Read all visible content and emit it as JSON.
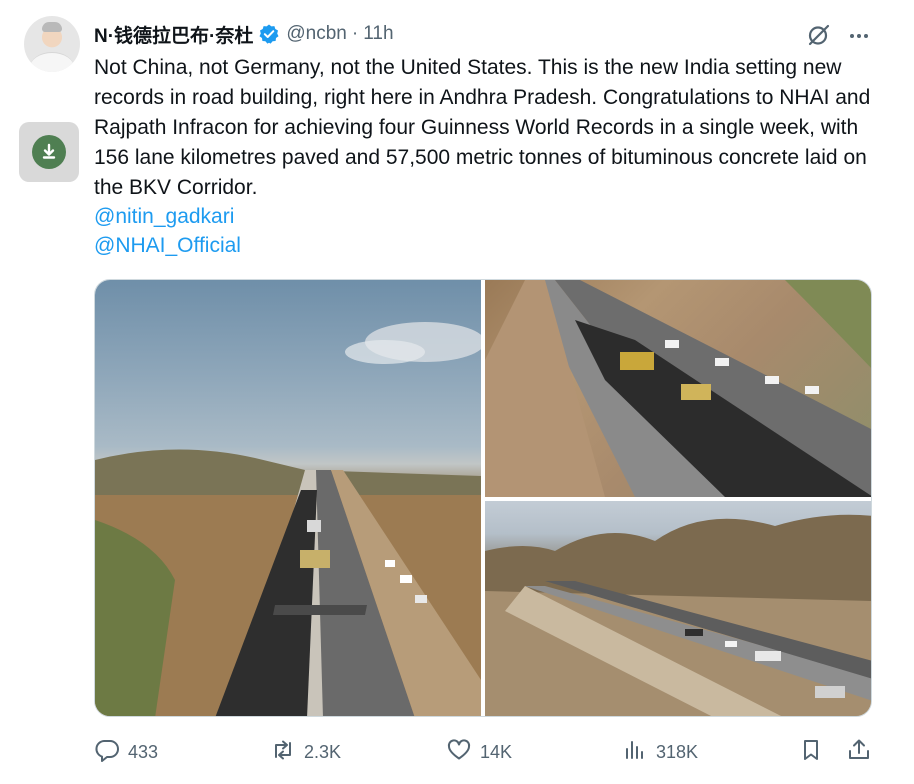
{
  "author": {
    "name": "N·钱德拉巴布·奈杜",
    "handle": "@ncbn",
    "separator": "·",
    "time": "11h",
    "verified": true
  },
  "tweet": {
    "text": "Not China, not Germany, not the United States. This is the new India setting new records in road building, right here in Andhra Pradesh. Congratulations to NHAI and Rajpath Infracon for achieving four Guinness World Records in a single week, with 156 lane kilometres paved and 57,500 metric tonnes of bituminous concrete laid on the BKV Corridor.",
    "mentions": [
      "@nitin_gadkari",
      "@NHAI_Official"
    ]
  },
  "media": {
    "count": 3
  },
  "stats": {
    "replies": "433",
    "reposts": "2.3K",
    "likes": "14K",
    "views": "318K"
  },
  "colors": {
    "link": "#1d9bf0",
    "text": "#0f1419",
    "secondary": "#536471",
    "verified": "#1d9bf0",
    "border": "#cfd9de"
  },
  "icons": {
    "verified": "verified-badge-icon",
    "grok": "grok-icon",
    "more": "more-icon",
    "download": "download-icon",
    "reply": "reply-icon",
    "repost": "repost-icon",
    "like": "heart-icon",
    "views": "views-icon",
    "bookmark": "bookmark-icon",
    "share": "share-icon"
  }
}
